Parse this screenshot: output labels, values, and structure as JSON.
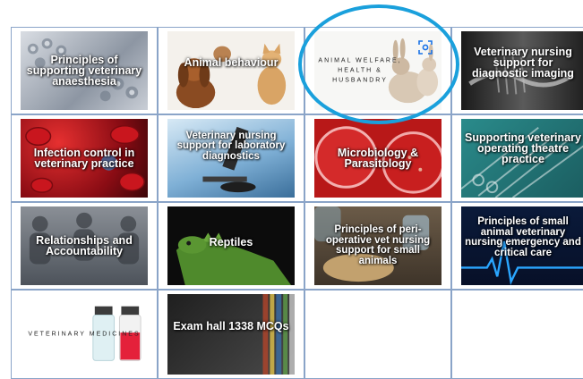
{
  "tiles": [
    {
      "id": "anaesthesia",
      "label": "Principles of supporting veterinary anaesthesia",
      "icon": "surgical-lights-image"
    },
    {
      "id": "animal-behaviour",
      "label": "Animal behaviour",
      "icon": "dog-cat-image"
    },
    {
      "id": "animal-welfare",
      "label": "ANIMAL WELFARE, HEALTH & HUSBANDRY",
      "icon": "rabbits-image",
      "lens_icon": "visual-search-icon"
    },
    {
      "id": "diagnostic-imaging",
      "label": "Veterinary nursing support for diagnostic imaging",
      "icon": "xray-image"
    },
    {
      "id": "infection-control",
      "label": "Infection control in veterinary practice",
      "icon": "blood-cells-image"
    },
    {
      "id": "lab-diagnostics",
      "label": "Veterinary nursing support for laboratory diagnostics",
      "icon": "microscope-image"
    },
    {
      "id": "microbiology",
      "label": "Microbiology & Parasitology",
      "icon": "petri-dish-image"
    },
    {
      "id": "operating-theatre",
      "label": "Supporting veterinary operating theatre practice",
      "icon": "surgical-instruments-image"
    },
    {
      "id": "relationships",
      "label": "Relationships and Accountability",
      "icon": "group-meeting-image"
    },
    {
      "id": "reptiles",
      "label": "Reptiles",
      "icon": "iguana-image"
    },
    {
      "id": "peri-operative",
      "label": "Principles of peri-operative vet nursing support for small animals",
      "icon": "dog-surgery-image"
    },
    {
      "id": "emergency-care",
      "label": "Principles of small animal veterinary nursing emergency and critical care",
      "icon": "ecg-pulse-image"
    },
    {
      "id": "veterinary-medicines",
      "label": "VETERINARY MEDICINES",
      "icon": "vials-image"
    },
    {
      "id": "exam-hall",
      "label": "Exam hall 1338 MCQs",
      "icon": "library-books-image"
    }
  ],
  "colors": {
    "grid_border": "#8aa4c8",
    "highlight": "#1aa0dc"
  }
}
